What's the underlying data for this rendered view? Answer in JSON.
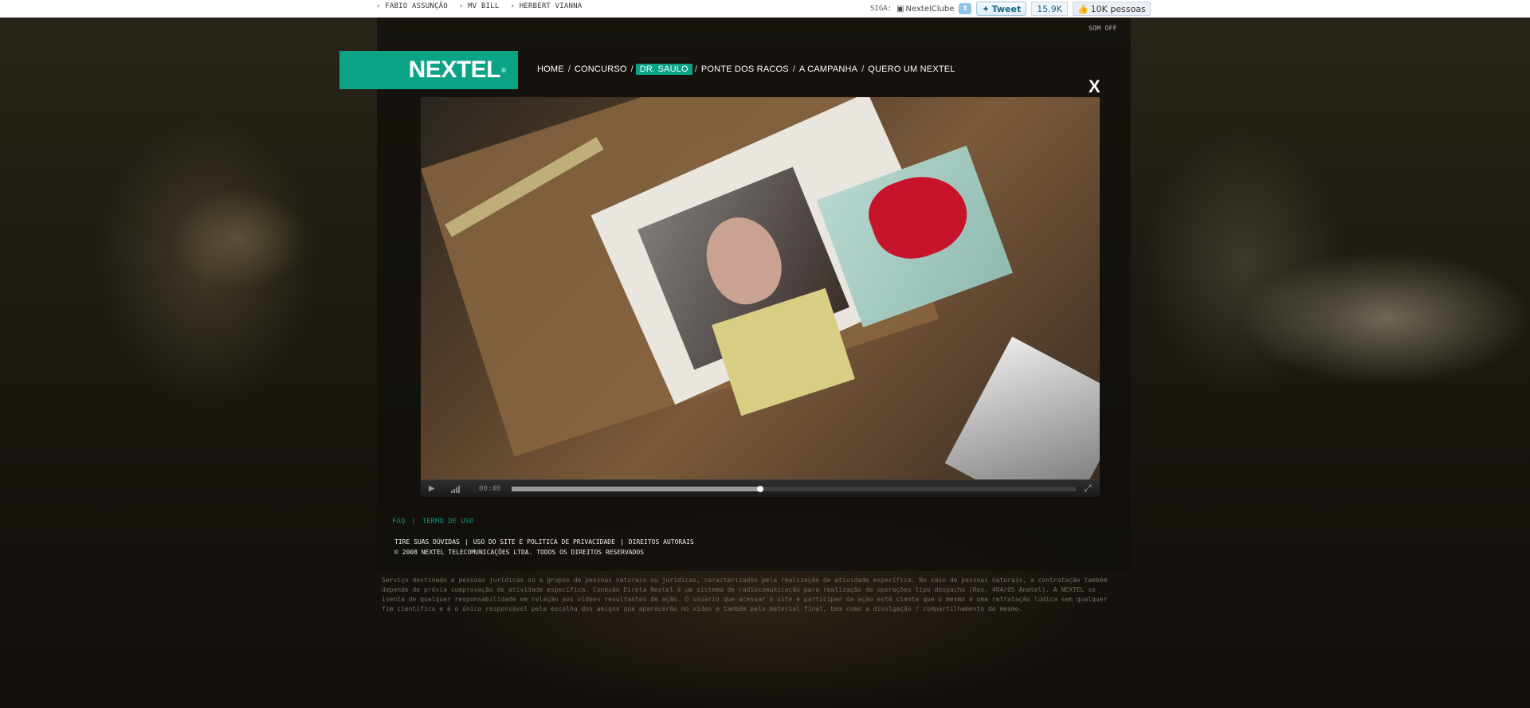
{
  "topnav": {
    "links": [
      "› FABIO ASSUNÇÃO",
      "› MV BILL",
      "› HERBERT VIANNA"
    ]
  },
  "social": {
    "siga_label": "SIGA:",
    "handle": "NextelClube",
    "tweet_label": "Tweet",
    "tweet_count": "15.9K",
    "like_label": "10K pessoas"
  },
  "header": {
    "som_off": "SOM OFF",
    "logo": "NEXTEL",
    "close": "X"
  },
  "nav": {
    "items": [
      {
        "label": "HOME",
        "active": false
      },
      {
        "label": "CONCURSO",
        "active": false
      },
      {
        "label": "DR. SAULO",
        "active": true
      },
      {
        "label": "PONTE DOS RACOS",
        "active": false
      },
      {
        "label": "A CAMPANHA",
        "active": false
      },
      {
        "label": "QUERO UM NEXTEL",
        "active": false
      }
    ],
    "separator": "/"
  },
  "player": {
    "time": "00:40",
    "progress": 0.44
  },
  "footer": {
    "faq": "FAQ",
    "pipe": "|",
    "termo": "TERMO DE USO",
    "legal_links": [
      "TIRE SUAS DÚVIDAS",
      "|",
      "USO DO SITE E POLITICA DE PRIVACIDADE",
      "|",
      "DIREITOS AUTORAIS"
    ],
    "copyright": "© 2008 NEXTEL TELECOMUNICAÇÕES LTDA. TODOS OS DIREITOS RESERVADOS"
  },
  "disclaimer": "Serviço destinado a pessoas jurídicas ou a grupos de pessoas naturais ou jurídicas, caracterizados pela realização de atividade específica. No caso de pessoas naturais, a contratação também depende de prévia comprovação de atividade específica. Conexão Direta Nextel é um sistema de radiocomunicação para realização de operações tipo despacho (Res. 404/05 Anatel). A NEXTEL se isenta de qualquer responsabilidade em relação aos vídeos resultantes de ação. O usuário que acessar o site e participar da ação está ciente que o mesmo é uma retratação lúdica sem qualquer fim científico e é o único responsável pela escolha dos amigos que aparecerão no vídeo e também pelo material final, bem como a divulgação / compartilhamento do mesmo.",
  "colors": {
    "brand_green": "#0aa386",
    "link_green": "#0d8c74"
  }
}
